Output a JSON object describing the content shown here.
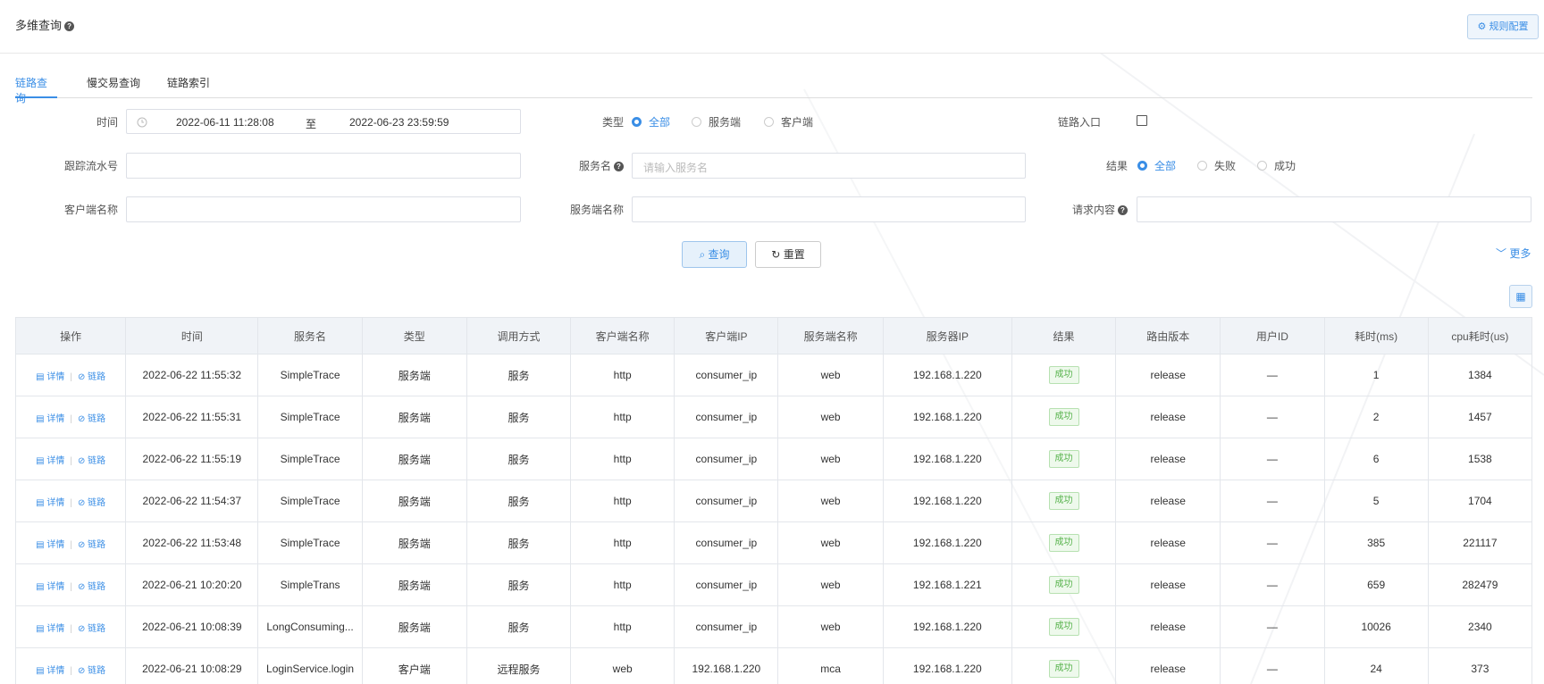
{
  "header": {
    "title": "多维查询",
    "help_icon": "?",
    "rule_button": "⚙ 规则配置"
  },
  "tabs": [
    "链路查询",
    "慢交易查询",
    "链路索引"
  ],
  "filters": {
    "time_label": "时间",
    "time_start": "2022-06-11 11:28:08",
    "time_sep": "至",
    "time_end": "2022-06-23 23:59:59",
    "type_label": "类型",
    "type_options": [
      "全部",
      "服务端",
      "客户端"
    ],
    "entry_label": "链路入口",
    "trace_label": "跟踪流水号",
    "service_label": "服务名",
    "service_placeholder": "请输入服务名",
    "result_label": "结果",
    "result_options": [
      "全部",
      "失败",
      "成功"
    ],
    "client_label": "客户端名称",
    "server_label": "服务端名称",
    "request_label": "请求内容"
  },
  "buttons": {
    "query": "查询",
    "reset": "重置",
    "more": "更多"
  },
  "table": {
    "headers": [
      "操作",
      "时间",
      "服务名",
      "类型",
      "调用方式",
      "客户端名称",
      "客户端IP",
      "服务端名称",
      "服务器IP",
      "结果",
      "路由版本",
      "用户ID",
      "耗时(ms)",
      "cpu耗时(us)"
    ],
    "op_detail": "详情",
    "op_link": "链路",
    "rows": [
      [
        "2022-06-22 11:55:32",
        "SimpleTrace",
        "服务端",
        "服务",
        "http",
        "consumer_ip",
        "web",
        "192.168.1.220",
        "成功",
        "release",
        "—",
        "1",
        "1384"
      ],
      [
        "2022-06-22 11:55:31",
        "SimpleTrace",
        "服务端",
        "服务",
        "http",
        "consumer_ip",
        "web",
        "192.168.1.220",
        "成功",
        "release",
        "—",
        "2",
        "1457"
      ],
      [
        "2022-06-22 11:55:19",
        "SimpleTrace",
        "服务端",
        "服务",
        "http",
        "consumer_ip",
        "web",
        "192.168.1.220",
        "成功",
        "release",
        "—",
        "6",
        "1538"
      ],
      [
        "2022-06-22 11:54:37",
        "SimpleTrace",
        "服务端",
        "服务",
        "http",
        "consumer_ip",
        "web",
        "192.168.1.220",
        "成功",
        "release",
        "—",
        "5",
        "1704"
      ],
      [
        "2022-06-22 11:53:48",
        "SimpleTrace",
        "服务端",
        "服务",
        "http",
        "consumer_ip",
        "web",
        "192.168.1.220",
        "成功",
        "release",
        "—",
        "385",
        "221117"
      ],
      [
        "2022-06-21 10:20:20",
        "SimpleTrans",
        "服务端",
        "服务",
        "http",
        "consumer_ip",
        "web",
        "192.168.1.221",
        "成功",
        "release",
        "—",
        "659",
        "282479"
      ],
      [
        "2022-06-21 10:08:39",
        "LongConsuming...",
        "服务端",
        "服务",
        "http",
        "consumer_ip",
        "web",
        "192.168.1.220",
        "成功",
        "release",
        "—",
        "10026",
        "2340"
      ],
      [
        "2022-06-21 10:08:29",
        "LoginService.login",
        "客户端",
        "远程服务",
        "web",
        "192.168.1.220",
        "mca",
        "192.168.1.220",
        "成功",
        "release",
        "—",
        "24",
        "373"
      ]
    ]
  }
}
